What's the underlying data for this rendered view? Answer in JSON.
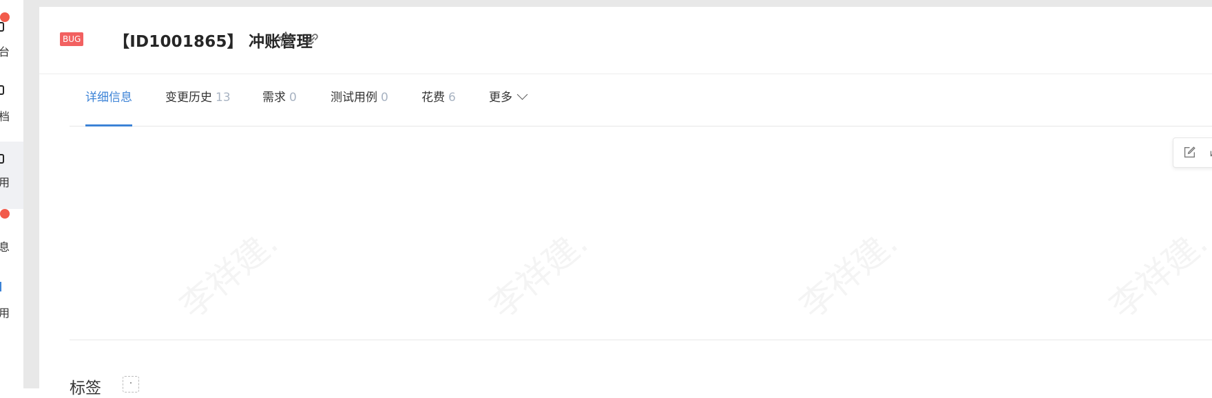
{
  "sidebar": {
    "items": [
      {
        "label": "台",
        "badge": true
      },
      {
        "label": "档",
        "badge": false
      },
      {
        "label": "用",
        "badge": false,
        "active": true
      },
      {
        "label": "息",
        "badge": true
      },
      {
        "label": "用",
        "badge": false
      }
    ]
  },
  "header": {
    "type_badge": "BUG",
    "title": "【ID1001865】 冲账管理",
    "star_icon": "star-outline-icon",
    "link_icon": "link-icon"
  },
  "tabs": [
    {
      "label": "详细信息",
      "count": "",
      "active": true
    },
    {
      "label": "变更历史",
      "count": "13"
    },
    {
      "label": "需求",
      "count": "0"
    },
    {
      "label": "测试用例",
      "count": "0"
    },
    {
      "label": "花费",
      "count": "6"
    },
    {
      "label": "更多",
      "count": "",
      "dropdown": true
    }
  ],
  "toolbar": {
    "edit_icon": "edit-icon",
    "collapse_icon": "collapse-arrow-icon"
  },
  "watermark": {
    "text": "李祥建."
  },
  "tags_section": {
    "label": "标签"
  },
  "colors": {
    "accent": "#3b82d6",
    "bug_badge": "#f26060",
    "notification_dot": "#f25b4b",
    "count_text": "#a8b3c2"
  }
}
